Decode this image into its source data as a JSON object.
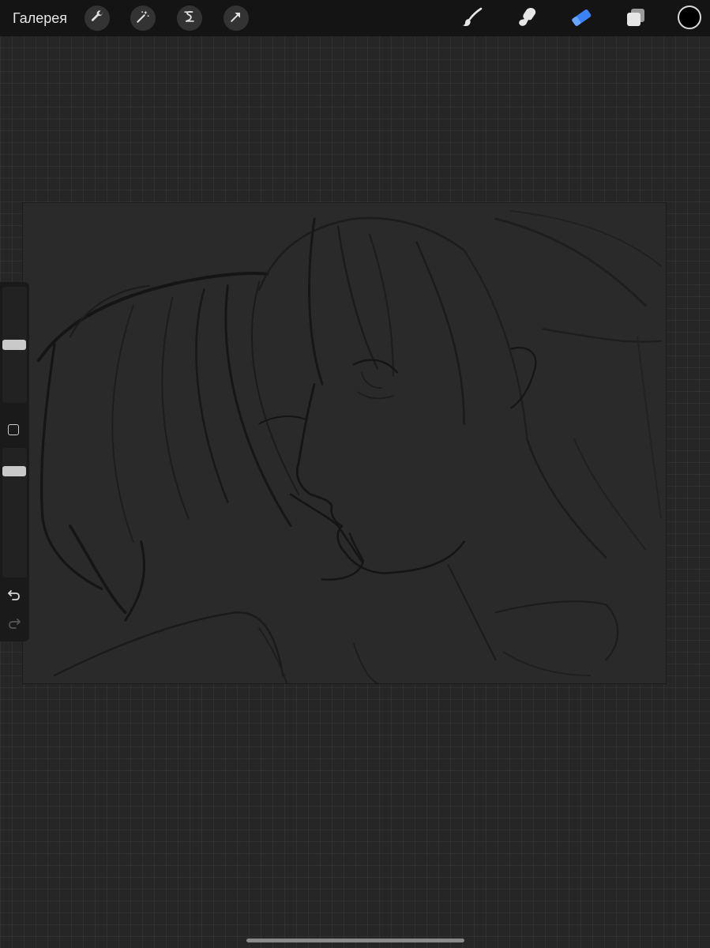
{
  "topbar": {
    "gallery_label": "Галерея",
    "left_tools": [
      "wrench-icon",
      "magic-wand-icon",
      "selection-icon",
      "transform-arrow-icon"
    ],
    "right_tools": [
      "brush-icon",
      "smudge-icon",
      "eraser-icon",
      "layers-icon"
    ],
    "active_tool": "eraser-icon",
    "active_color": "#3b82f6",
    "current_color": "#000000"
  },
  "sidebar": {
    "brush_size_level": 0.5,
    "opacity_level": 0.85,
    "controls": [
      "modify-button",
      "undo-icon",
      "redo-icon"
    ]
  },
  "canvas": {
    "background": "#2a2a2a"
  }
}
